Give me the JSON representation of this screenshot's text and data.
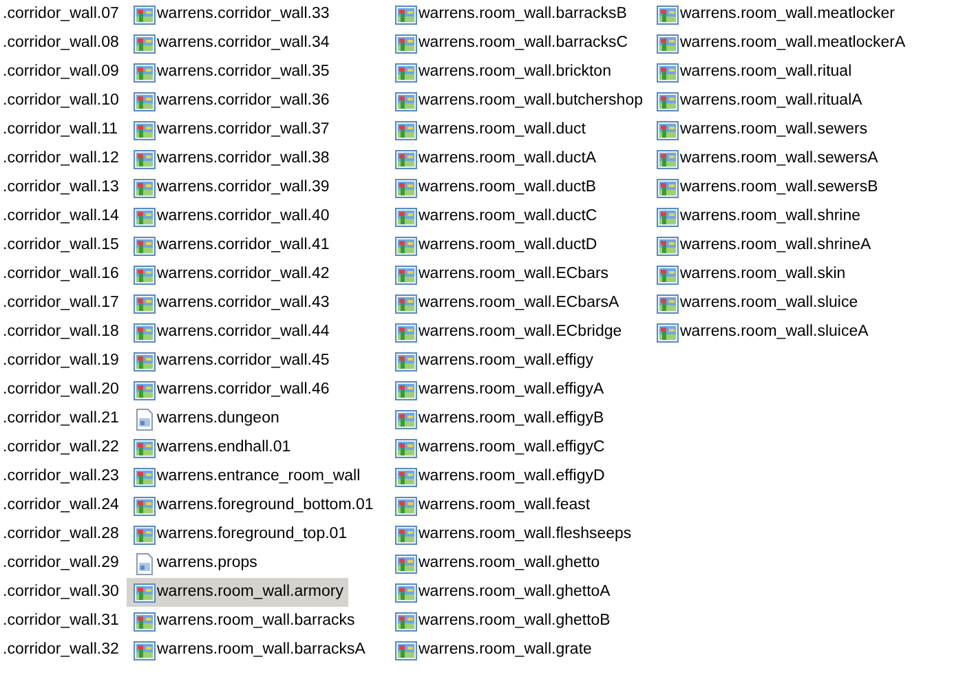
{
  "columns": [
    {
      "items": [
        {
          "label": ".corridor_wall.07",
          "selected": false
        },
        {
          "label": ".corridor_wall.08",
          "selected": false
        },
        {
          "label": ".corridor_wall.09",
          "selected": false
        },
        {
          "label": ".corridor_wall.10",
          "selected": false
        },
        {
          "label": ".corridor_wall.11",
          "selected": false
        },
        {
          "label": ".corridor_wall.12",
          "selected": false
        },
        {
          "label": ".corridor_wall.13",
          "selected": false
        },
        {
          "label": ".corridor_wall.14",
          "selected": false
        },
        {
          "label": ".corridor_wall.15",
          "selected": false
        },
        {
          "label": ".corridor_wall.16",
          "selected": false
        },
        {
          "label": ".corridor_wall.17",
          "selected": false
        },
        {
          "label": ".corridor_wall.18",
          "selected": false
        },
        {
          "label": ".corridor_wall.19",
          "selected": false
        },
        {
          "label": ".corridor_wall.20",
          "selected": false
        },
        {
          "label": ".corridor_wall.21",
          "selected": false
        },
        {
          "label": ".corridor_wall.22",
          "selected": false
        },
        {
          "label": ".corridor_wall.23",
          "selected": false
        },
        {
          "label": ".corridor_wall.24",
          "selected": false
        },
        {
          "label": ".corridor_wall.28",
          "selected": false
        },
        {
          "label": ".corridor_wall.29",
          "selected": false
        },
        {
          "label": ".corridor_wall.30",
          "selected": false
        },
        {
          "label": ".corridor_wall.31",
          "selected": false
        },
        {
          "label": ".corridor_wall.32",
          "selected": false
        }
      ]
    },
    {
      "items": [
        {
          "label": "warrens.corridor_wall.33",
          "kind": "image",
          "selected": false
        },
        {
          "label": "warrens.corridor_wall.34",
          "kind": "image",
          "selected": false
        },
        {
          "label": "warrens.corridor_wall.35",
          "kind": "image",
          "selected": false
        },
        {
          "label": "warrens.corridor_wall.36",
          "kind": "image",
          "selected": false
        },
        {
          "label": "warrens.corridor_wall.37",
          "kind": "image",
          "selected": false
        },
        {
          "label": "warrens.corridor_wall.38",
          "kind": "image",
          "selected": false
        },
        {
          "label": "warrens.corridor_wall.39",
          "kind": "image",
          "selected": false
        },
        {
          "label": "warrens.corridor_wall.40",
          "kind": "image",
          "selected": false
        },
        {
          "label": "warrens.corridor_wall.41",
          "kind": "image",
          "selected": false
        },
        {
          "label": "warrens.corridor_wall.42",
          "kind": "image",
          "selected": false
        },
        {
          "label": "warrens.corridor_wall.43",
          "kind": "image",
          "selected": false
        },
        {
          "label": "warrens.corridor_wall.44",
          "kind": "image",
          "selected": false
        },
        {
          "label": "warrens.corridor_wall.45",
          "kind": "image",
          "selected": false
        },
        {
          "label": "warrens.corridor_wall.46",
          "kind": "image",
          "selected": false
        },
        {
          "label": "warrens.dungeon",
          "kind": "document",
          "selected": false
        },
        {
          "label": "warrens.endhall.01",
          "kind": "image",
          "selected": false
        },
        {
          "label": "warrens.entrance_room_wall",
          "kind": "image",
          "selected": false
        },
        {
          "label": "warrens.foreground_bottom.01",
          "kind": "image",
          "selected": false
        },
        {
          "label": "warrens.foreground_top.01",
          "kind": "image",
          "selected": false
        },
        {
          "label": "warrens.props",
          "kind": "document",
          "selected": false
        },
        {
          "label": "warrens.room_wall.armory",
          "kind": "image",
          "selected": true
        },
        {
          "label": "warrens.room_wall.barracks",
          "kind": "image",
          "selected": false
        },
        {
          "label": "warrens.room_wall.barracksA",
          "kind": "image",
          "selected": false
        }
      ]
    },
    {
      "items": [
        {
          "label": "warrens.room_wall.barracksB",
          "kind": "image",
          "selected": false
        },
        {
          "label": "warrens.room_wall.barracksC",
          "kind": "image",
          "selected": false
        },
        {
          "label": "warrens.room_wall.brickton",
          "kind": "image",
          "selected": false
        },
        {
          "label": "warrens.room_wall.butchershop",
          "kind": "image",
          "selected": false
        },
        {
          "label": "warrens.room_wall.duct",
          "kind": "image",
          "selected": false
        },
        {
          "label": "warrens.room_wall.ductA",
          "kind": "image",
          "selected": false
        },
        {
          "label": "warrens.room_wall.ductB",
          "kind": "image",
          "selected": false
        },
        {
          "label": "warrens.room_wall.ductC",
          "kind": "image",
          "selected": false
        },
        {
          "label": "warrens.room_wall.ductD",
          "kind": "image",
          "selected": false
        },
        {
          "label": "warrens.room_wall.ECbars",
          "kind": "image",
          "selected": false
        },
        {
          "label": "warrens.room_wall.ECbarsA",
          "kind": "image",
          "selected": false
        },
        {
          "label": "warrens.room_wall.ECbridge",
          "kind": "image",
          "selected": false
        },
        {
          "label": "warrens.room_wall.effigy",
          "kind": "image",
          "selected": false
        },
        {
          "label": "warrens.room_wall.effigyA",
          "kind": "image",
          "selected": false
        },
        {
          "label": "warrens.room_wall.effigyB",
          "kind": "image",
          "selected": false
        },
        {
          "label": "warrens.room_wall.effigyC",
          "kind": "image",
          "selected": false
        },
        {
          "label": "warrens.room_wall.effigyD",
          "kind": "image",
          "selected": false
        },
        {
          "label": "warrens.room_wall.feast",
          "kind": "image",
          "selected": false
        },
        {
          "label": "warrens.room_wall.fleshseeps",
          "kind": "image",
          "selected": false
        },
        {
          "label": "warrens.room_wall.ghetto",
          "kind": "image",
          "selected": false
        },
        {
          "label": "warrens.room_wall.ghettoA",
          "kind": "image",
          "selected": false
        },
        {
          "label": "warrens.room_wall.ghettoB",
          "kind": "image",
          "selected": false
        },
        {
          "label": "warrens.room_wall.grate",
          "kind": "image",
          "selected": false
        }
      ]
    },
    {
      "items": [
        {
          "label": "warrens.room_wall.meatlocker",
          "kind": "image",
          "selected": false
        },
        {
          "label": "warrens.room_wall.meatlockerA",
          "kind": "image",
          "selected": false
        },
        {
          "label": "warrens.room_wall.ritual",
          "kind": "image",
          "selected": false
        },
        {
          "label": "warrens.room_wall.ritualA",
          "kind": "image",
          "selected": false
        },
        {
          "label": "warrens.room_wall.sewers",
          "kind": "image",
          "selected": false
        },
        {
          "label": "warrens.room_wall.sewersA",
          "kind": "image",
          "selected": false
        },
        {
          "label": "warrens.room_wall.sewersB",
          "kind": "image",
          "selected": false
        },
        {
          "label": "warrens.room_wall.shrine",
          "kind": "image",
          "selected": false
        },
        {
          "label": "warrens.room_wall.shrineA",
          "kind": "image",
          "selected": false
        },
        {
          "label": "warrens.room_wall.skin",
          "kind": "image",
          "selected": false
        },
        {
          "label": "warrens.room_wall.sluice",
          "kind": "image",
          "selected": false
        },
        {
          "label": "warrens.room_wall.sluiceA",
          "kind": "image",
          "selected": false
        }
      ]
    }
  ]
}
